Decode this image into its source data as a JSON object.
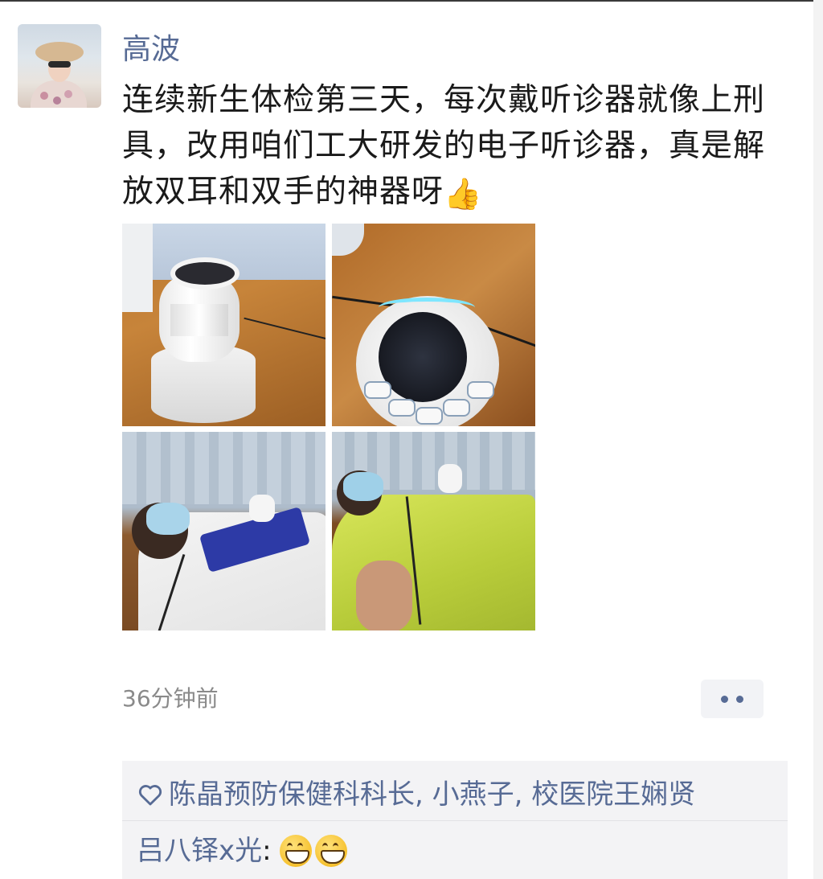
{
  "post": {
    "author": "高波",
    "text": "连续新生体检第三天，每次戴听诊器就像上刑具，改用咱们工大研发的电子听诊器，真是解放双耳和双手的神器呀",
    "text_emoji": "👍",
    "timestamp": "36分钟前",
    "photos": [
      {
        "name": "stethoscope-device-on-table"
      },
      {
        "name": "stethoscope-device-closeup"
      },
      {
        "name": "student-white-shirt-exam"
      },
      {
        "name": "student-green-shirt-exam"
      }
    ]
  },
  "interactions": {
    "like_icon": "heart-icon",
    "likes": "陈晶预防保健科科长, 小燕子, 校医院王娴贤",
    "comment": {
      "author": "吕八铎x光",
      "separator": ":",
      "emojis": [
        "grin-icon",
        "grin-icon"
      ]
    }
  },
  "more_button_icon": "more-dots-icon",
  "colors": {
    "link_blue": "#576b95",
    "text": "#1a1a1a",
    "muted": "#8a8a8a",
    "comment_bg": "#f3f3f5"
  }
}
